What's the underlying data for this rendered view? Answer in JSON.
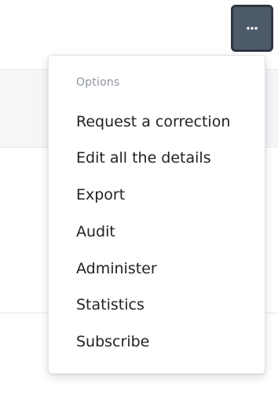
{
  "more_button": {
    "icon": "more-horizontal-icon",
    "color": "#4d5a69"
  },
  "menu": {
    "header": "Options",
    "items": [
      {
        "label": "Request a correction"
      },
      {
        "label": "Edit all the details"
      },
      {
        "label": "Export"
      },
      {
        "label": "Audit"
      },
      {
        "label": "Administer"
      },
      {
        "label": "Statistics"
      },
      {
        "label": "Subscribe"
      }
    ]
  }
}
